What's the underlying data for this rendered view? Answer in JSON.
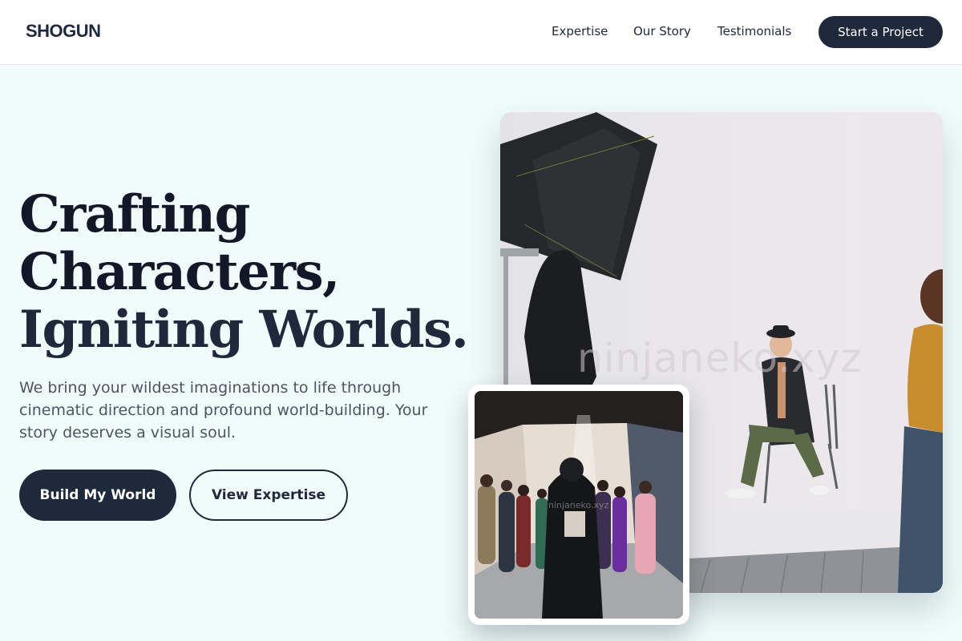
{
  "header": {
    "logo": "SHOGUN",
    "nav": {
      "expertise": "Expertise",
      "our_story": "Our Story",
      "testimonials": "Testimonials"
    },
    "cta_label": "Start a Project"
  },
  "hero": {
    "title_lines": [
      "Crafting",
      "Characters,",
      "Igniting Worlds."
    ],
    "subtitle": "We bring your wildest imaginations to life through cinematic direction and profound world-building. Your story deserves a visual soul.",
    "primary_button": "Build My World",
    "secondary_button": "View Expertise"
  },
  "images": {
    "main_photo_watermark": "ninjaneko.xyz",
    "small_photo_watermark": "ninjaneko.xyz"
  },
  "colors": {
    "primary": "#1e293b",
    "background": "#effcfa",
    "header_bg": "#ffffff",
    "text_muted": "#4b5563"
  }
}
